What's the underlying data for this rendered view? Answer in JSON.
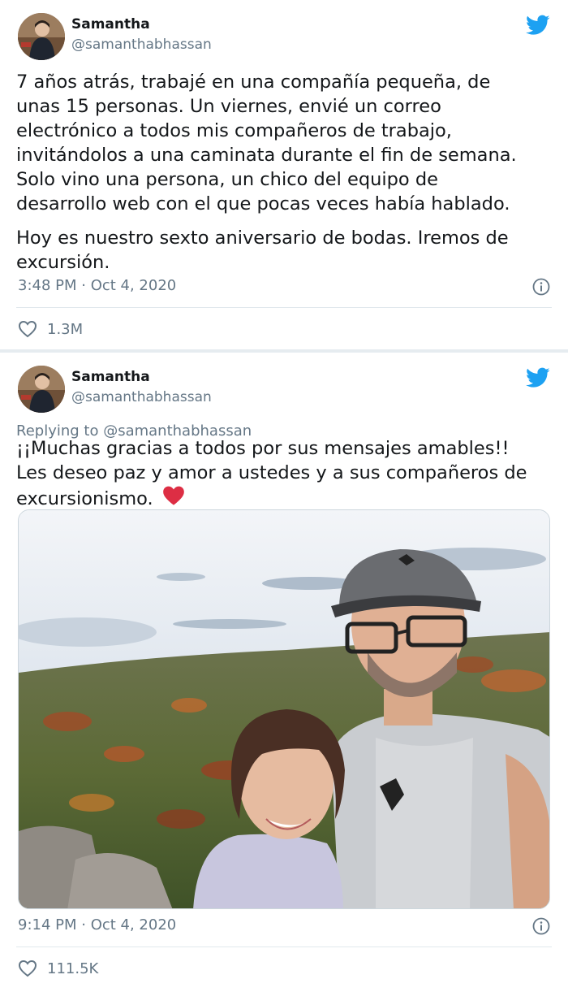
{
  "tweet1": {
    "author_name": "Samantha",
    "author_handle": "@samanthabhassan",
    "lines": [
      "7 años atrás, trabajé en una compañía pequeña, de",
      "unas 15 personas. Un viernes, envié un correo",
      "electrónico a todos mis compañeros de trabajo,",
      "invitándolos a una caminata durante el fin de semana.",
      "Solo vino una persona, un chico del equipo de",
      "desarrollo web con el que pocas veces había hablado.",
      "Hoy es nuestro sexto aniversario de bodas. Iremos de",
      "excursión."
    ],
    "timestamp": "3:48 PM · Oct 4, 2020",
    "likes": "1.3M"
  },
  "tweet2": {
    "author_name": "Samantha",
    "author_handle": "@samanthabhassan",
    "replying_to": "Replying to @samanthabhassan",
    "lines": [
      "¡¡Muchas gracias a todos por sus mensajes amables!!",
      "Les deseo paz y amor a ustedes y a sus compañeros de",
      "excursionismo."
    ],
    "timestamp": "9:14 PM · Oct 4, 2020",
    "likes": "111.5K"
  },
  "colors": {
    "twitter_blue": "#1da1f2",
    "secondary_text": "#657786",
    "heart_red": "#e0245e"
  },
  "icons": [
    "twitter-bird-icon",
    "info-icon",
    "heart-outline-icon",
    "red-heart-emoji"
  ]
}
